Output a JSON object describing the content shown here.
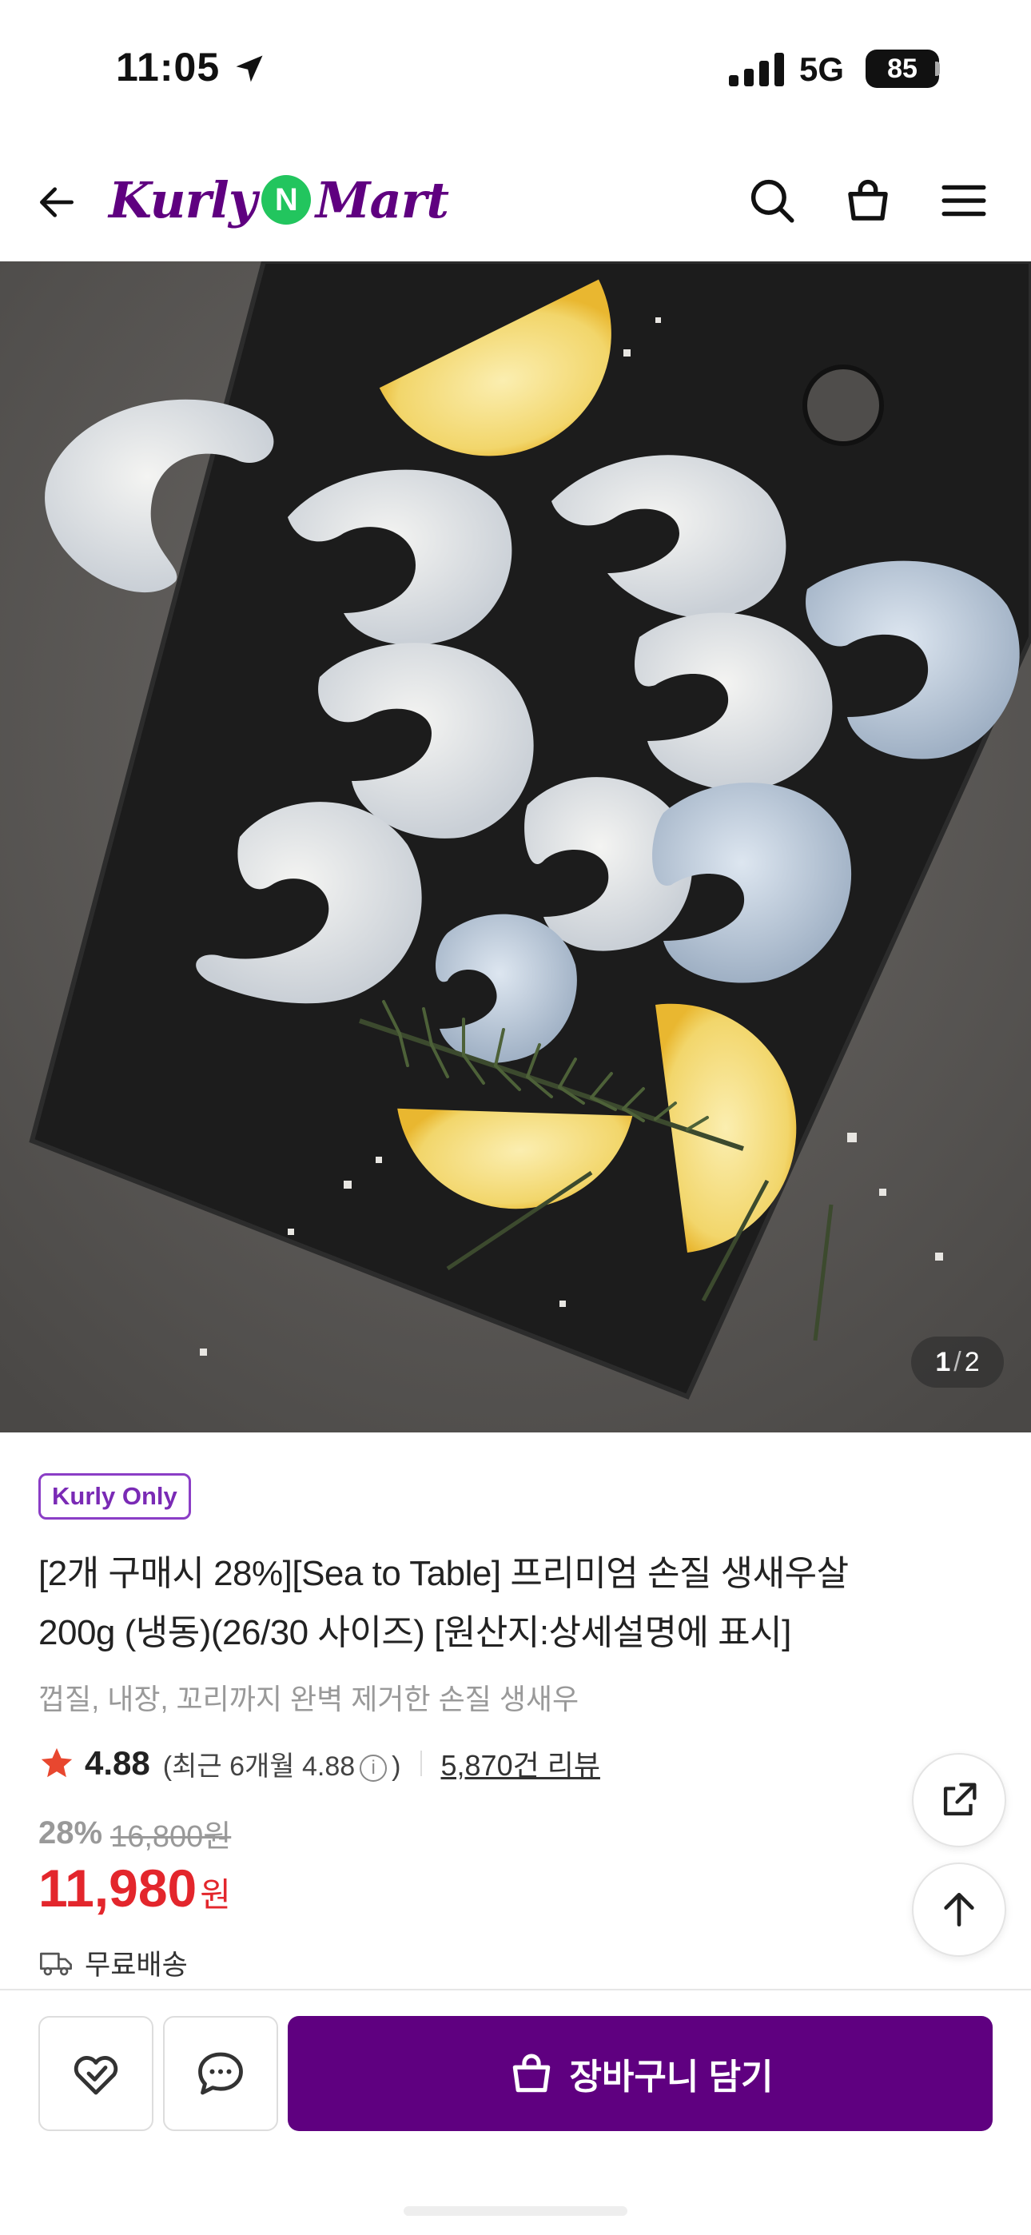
{
  "status_bar": {
    "time": "11:05",
    "network": "5G",
    "battery": "85"
  },
  "header": {
    "logo_left": "Kurly",
    "logo_mid": "N",
    "logo_right": "Mart"
  },
  "hero": {
    "page_current": "1",
    "page_total": "2"
  },
  "product": {
    "badge": "Kurly Only",
    "title_line1": "[2개 구매시 28%][Sea to Table] 프리미엄 손질 생새우살",
    "title_line2": "200g (냉동)(26/30 사이즈) [원산지:상세설명에 표시]",
    "subtitle": "껍질, 내장, 꼬리까지 완벽 제거한 손질 생새우",
    "rating": "4.88",
    "rating_recent_prefix": "(최근 6개월 4.88",
    "rating_recent_suffix": ")",
    "review_count": "5,870건 리뷰",
    "discount": "28%",
    "original_price": "16,800원",
    "price": "11,980",
    "currency": "원",
    "delivery": "무료배송"
  },
  "bottom_bar": {
    "cart_label": "장바구니 담기"
  },
  "colors": {
    "brand": "#5f0080",
    "price_red": "#e3262c",
    "star": "#e8472f",
    "logo_n": "#22c55e"
  }
}
